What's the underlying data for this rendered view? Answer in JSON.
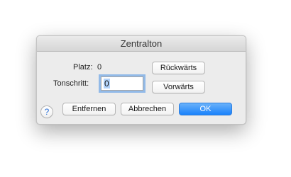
{
  "dialog": {
    "title": "Zentralton",
    "platz_label": "Platz:",
    "platz_value": "0",
    "tonschritt_label": "Tonschritt:",
    "tonschritt_value": "0",
    "back_button": "Rückwärts",
    "forward_button": "Vorwärts",
    "remove_button": "Entfernen",
    "cancel_button": "Abbrechen",
    "ok_button": "OK",
    "help_glyph": "?"
  },
  "colors": {
    "accent": "#1a82fb",
    "focus_ring": "#4891e6"
  },
  "icons": {
    "help": "question-mark-icon"
  }
}
